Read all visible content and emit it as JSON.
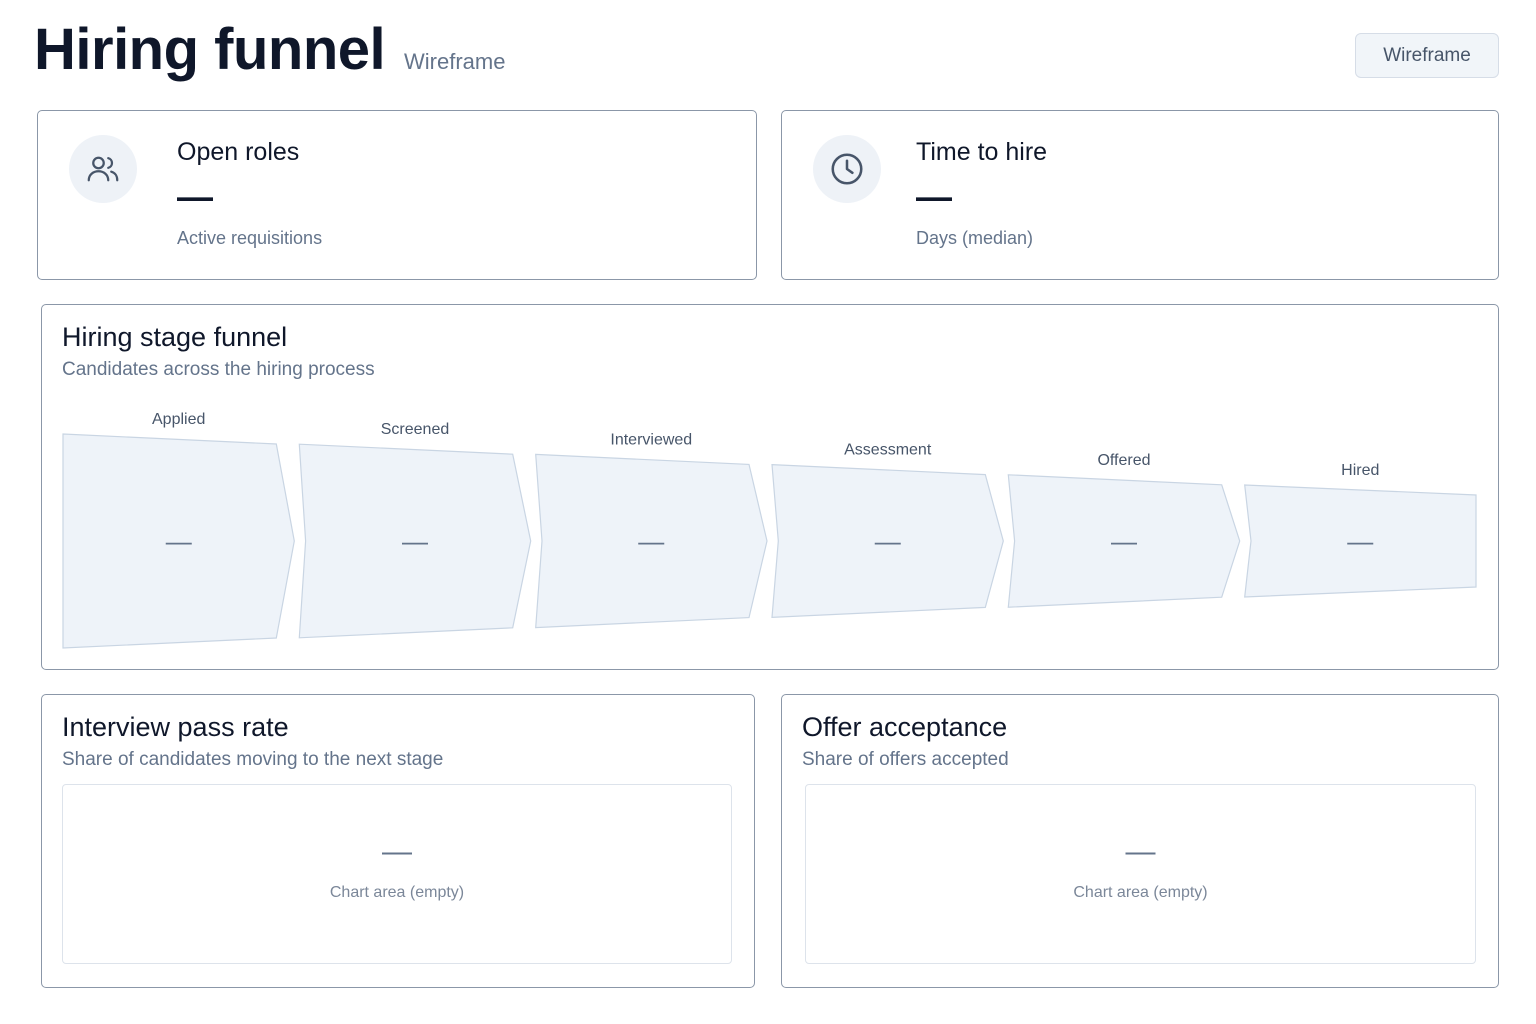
{
  "header": {
    "title": "Hiring funnel",
    "subtitle": "Wireframe",
    "button_label": "Wireframe"
  },
  "kpis": [
    {
      "title": "Open roles",
      "value": "—",
      "caption": "Active requisitions",
      "icon": "users-icon"
    },
    {
      "title": "Time to hire",
      "value": "—",
      "caption": "Days (median)",
      "icon": "clock-icon"
    }
  ],
  "funnel": {
    "title": "Hiring stage funnel",
    "subtitle": "Candidates across the hiring process",
    "stages": [
      {
        "label": "Applied",
        "value": "—"
      },
      {
        "label": "Screened",
        "value": "—"
      },
      {
        "label": "Interviewed",
        "value": "—"
      },
      {
        "label": "Assessment",
        "value": "—"
      },
      {
        "label": "Offered",
        "value": "—"
      },
      {
        "label": "Hired",
        "value": "—"
      }
    ]
  },
  "charts": [
    {
      "title": "Interview pass rate",
      "subtitle": "Share of candidates moving to the next stage",
      "value": "—",
      "empty_label": "Chart area (empty)"
    },
    {
      "title": "Offer acceptance",
      "subtitle": "Share of offers accepted",
      "value": "—",
      "empty_label": "Chart area (empty)"
    }
  ],
  "colors": {
    "text": "#0f172a",
    "muted": "#64748b",
    "border": "#8b97a8",
    "funnel_fill": "#eef3f9",
    "funnel_stroke": "#c9d5e3"
  }
}
